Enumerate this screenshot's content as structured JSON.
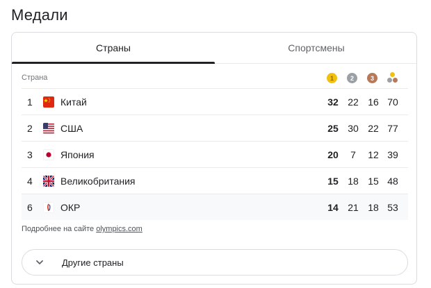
{
  "title": "Медали",
  "tabs": [
    {
      "label": "Страны",
      "active": true
    },
    {
      "label": "Спортсмены",
      "active": false
    }
  ],
  "table": {
    "header": {
      "country_label": "Страна",
      "gold": "1",
      "silver": "2",
      "bronze": "3"
    },
    "rows": [
      {
        "rank": "1",
        "country": "Китай",
        "flag": "china-flag-icon",
        "gold": "32",
        "silver": "22",
        "bronze": "16",
        "total": "70"
      },
      {
        "rank": "2",
        "country": "США",
        "flag": "usa-flag-icon",
        "gold": "25",
        "silver": "30",
        "bronze": "22",
        "total": "77"
      },
      {
        "rank": "3",
        "country": "Япония",
        "flag": "japan-flag-icon",
        "gold": "20",
        "silver": "7",
        "bronze": "12",
        "total": "39"
      },
      {
        "rank": "4",
        "country": "Великобритания",
        "flag": "uk-flag-icon",
        "gold": "15",
        "silver": "18",
        "bronze": "15",
        "total": "48"
      },
      {
        "rank": "6",
        "country": "ОКР",
        "flag": "roc-flag-icon",
        "gold": "14",
        "silver": "21",
        "bronze": "18",
        "total": "53"
      }
    ]
  },
  "footnote": {
    "prefix": "Подробнее на сайте",
    "link": "olympics.com"
  },
  "more_button": {
    "label": "Другие страны",
    "icon": "chevron-down-icon"
  },
  "colors": {
    "gold": "#f2c10f",
    "silver": "#9aa0a6",
    "bronze": "#b8785a",
    "tab_active": "#202124"
  }
}
